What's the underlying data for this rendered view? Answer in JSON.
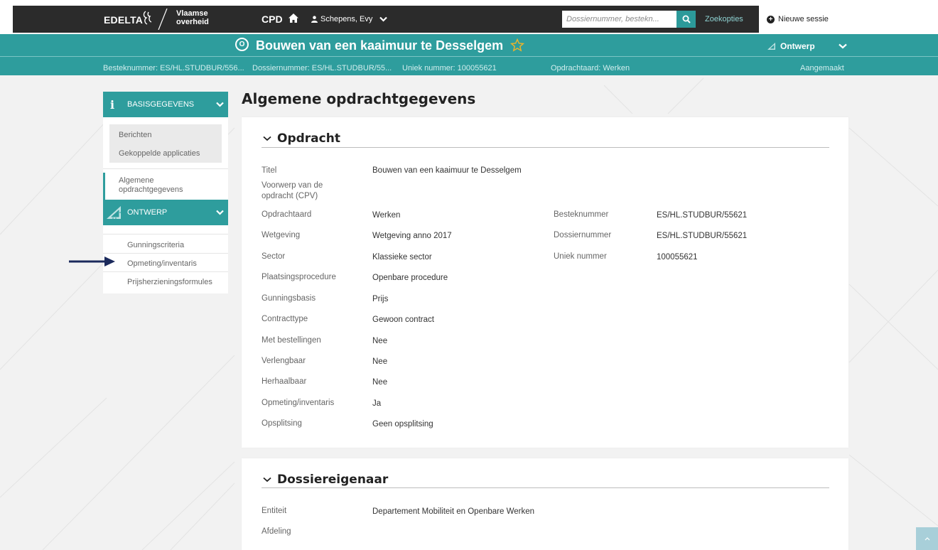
{
  "topbar": {
    "brand": "EDELTA",
    "gov_line1": "Vlaamse",
    "gov_line2": "overheid",
    "app": "CPD",
    "user": "Schepens, Evy",
    "search_placeholder": "Dossiernummer, bestekn...",
    "search_options": "Zoekopties",
    "new_session": "Nieuwe sessie"
  },
  "header": {
    "status_letter": "O",
    "title": "Bouwen van een kaaimuur te Desselgem",
    "phase": "Ontwerp",
    "meta": {
      "besteknummer": "Besteknummer: ES/HL.STUDBUR/556...",
      "dossiernummer": "Dossiernummer: ES/HL.STUDBUR/55...",
      "uniek": "Uniek nummer: 100055621",
      "opdrachtaard": "Opdrachtaard: Werken",
      "status": "Aangemaakt"
    }
  },
  "sidebar": {
    "section1": {
      "label": "BASISGEGEVENS",
      "items": [
        "Berichten",
        "Gekoppelde applicaties"
      ],
      "active_item_line1": "Algemene",
      "active_item_line2": "opdrachtgegevens"
    },
    "section2": {
      "label": "ONTWERP",
      "items": [
        "Gunningscriteria",
        "Opmeting/inventaris",
        "Prijsherzieningsformules"
      ]
    }
  },
  "main": {
    "title": "Algemene opdrachtgegevens",
    "opdracht": {
      "heading": "Opdracht",
      "left_rows": [
        {
          "label": "Titel",
          "value": "Bouwen van een kaaimuur te Desselgem"
        },
        {
          "label": "Voorwerp van de opdracht (CPV)",
          "value": ""
        },
        {
          "label": "Opdrachtaard",
          "value": "Werken"
        },
        {
          "label": "Wetgeving",
          "value": "Wetgeving anno 2017"
        },
        {
          "label": "Sector",
          "value": "Klassieke sector"
        },
        {
          "label": "Plaatsingsprocedure",
          "value": "Openbare procedure"
        },
        {
          "label": "Gunningsbasis",
          "value": "Prijs"
        },
        {
          "label": "Contracttype",
          "value": "Gewoon contract"
        },
        {
          "label": "Met bestellingen",
          "value": "Nee"
        },
        {
          "label": "Verlengbaar",
          "value": "Nee"
        },
        {
          "label": "Herhaalbaar",
          "value": "Nee"
        },
        {
          "label": "Opmeting/inventaris",
          "value": "Ja"
        },
        {
          "label": "Opsplitsing",
          "value": "Geen opsplitsing"
        }
      ],
      "right_rows": [
        {
          "label": "Besteknummer",
          "value": "ES/HL.STUDBUR/55621"
        },
        {
          "label": "Dossiernummer",
          "value": "ES/HL.STUDBUR/55621"
        },
        {
          "label": "Uniek nummer",
          "value": "100055621"
        }
      ]
    },
    "eigenaar": {
      "heading": "Dossiereigenaar",
      "rows": [
        {
          "label": "Entiteit",
          "value": "Departement Mobiliteit en Openbare Werken"
        },
        {
          "label": "Afdeling",
          "value": ""
        }
      ]
    }
  },
  "colors": {
    "teal": "#2e9d9d",
    "dark": "#2b2b2b",
    "arrow": "#1b2a5c",
    "star": "#f0b429"
  }
}
